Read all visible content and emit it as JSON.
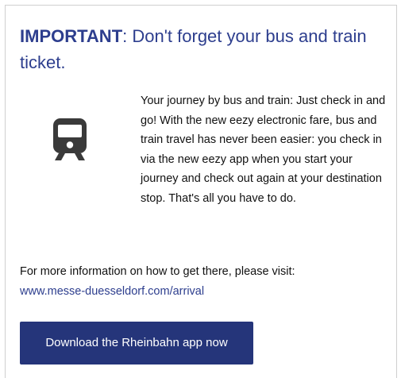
{
  "notice": {
    "title_strong": "IMPORTANT",
    "title_rest": ": Don't forget your bus and train ticket.",
    "icon": "train-icon",
    "body": "Your journey by bus and train: Just check in and go! With the new eezy electronic fare, bus and train travel has never been easier: you check in via the new eezy app when you start your journey and check out again at your destination stop. That's all you have to do.",
    "info_text": "For more information on how to get there, please visit:",
    "info_link": "www.messe-duesseldorf.com/arrival",
    "cta_label": "Download the Rheinbahn app now"
  },
  "colors": {
    "title": "#2d3e8e",
    "link": "#2d3e8e",
    "button_bg": "#25357a",
    "button_text": "#ffffff",
    "icon": "#3a3a3a",
    "border": "#cfcfcf"
  }
}
